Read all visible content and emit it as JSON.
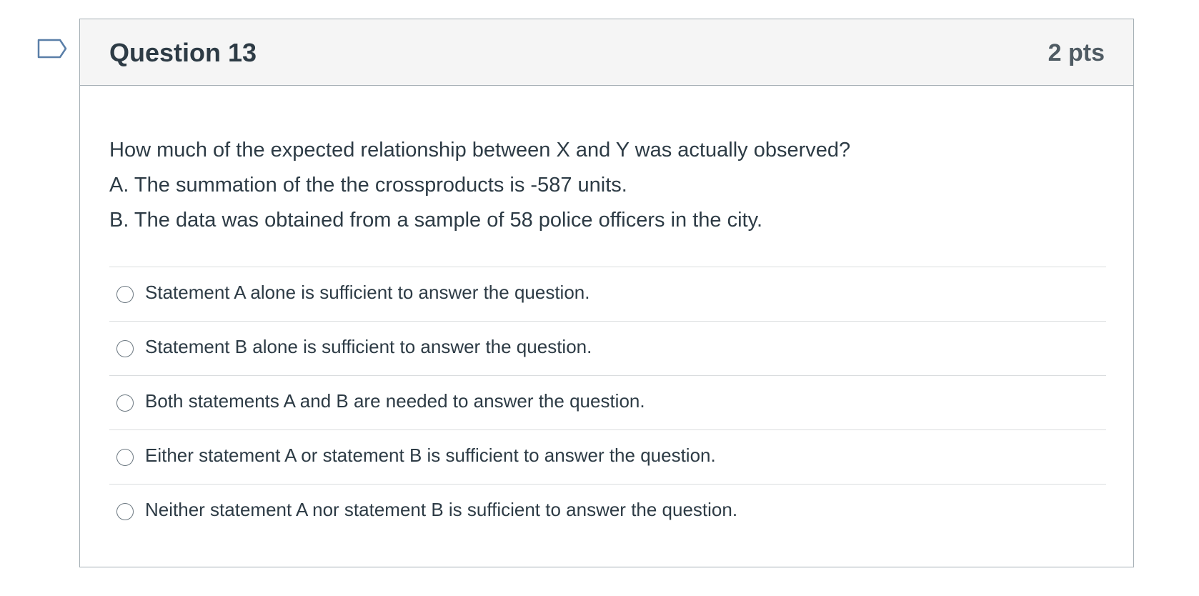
{
  "question": {
    "title": "Question 13",
    "points": "2 pts",
    "text_lines": [
      "How much of the expected relationship between X and Y was actually observed?",
      "A. The summation of the the crossproducts is -587 units.",
      "B. The data was obtained from a sample of 58 police officers in the city."
    ],
    "answers": [
      {
        "label": "Statement A alone is sufficient to answer the question.",
        "selected": false
      },
      {
        "label": "Statement B alone is sufficient to answer the question.",
        "selected": false
      },
      {
        "label": "Both statements A and B are needed to answer the question.",
        "selected": false
      },
      {
        "label": "Either statement A or statement B is sufficient to answer the question.",
        "selected": false
      },
      {
        "label": "Neither statement A nor statement B is sufficient to answer the question.",
        "selected": false
      }
    ]
  },
  "icons": {
    "flag": "flag-icon",
    "radio": "radio-button-icon"
  },
  "colors": {
    "header_background": "#f5f5f5",
    "border": "#a5afb5",
    "text": "#2d3b45",
    "flag_stroke": "#5a7fa8"
  }
}
